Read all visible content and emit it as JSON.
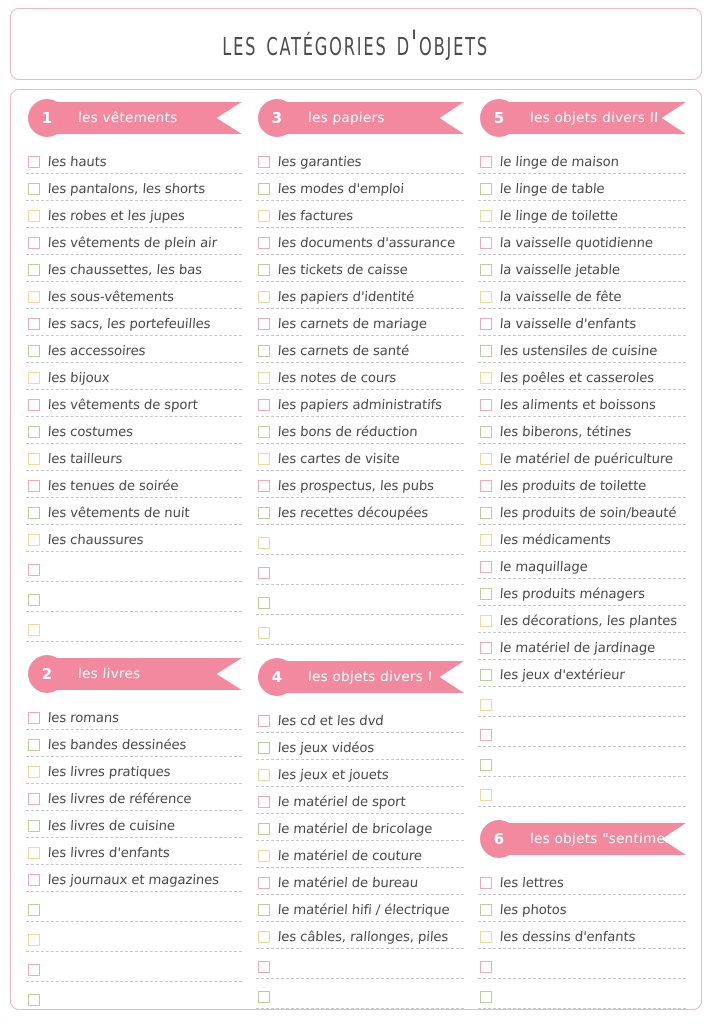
{
  "document": {
    "title": "Les catégories d'objets"
  },
  "colors": {
    "accent_pink": "#F2899F",
    "box_pink": "#F3A8BC",
    "box_green": "#BBCF9E",
    "box_yellow": "#F6D79A",
    "border_pink": "#F2B6C3",
    "blob_yellow": "#F8D48A",
    "blob_green": "#B3CC91",
    "blob_pink": "#EE7E9B",
    "text_dark": "#4A4A4A"
  },
  "header": {
    "blobs_left": [
      "blob_yellow",
      "blob_green",
      "blob_pink"
    ],
    "blobs_right": [
      "blob_pink",
      "blob_green",
      "blob_yellow"
    ]
  },
  "sections": [
    {
      "number": "1",
      "label": "les vêtements",
      "items": [
        "les hauts",
        "les pantalons, les shorts",
        "les robes et les jupes",
        "les vêtements de plein air",
        "les chaussettes, les bas",
        "les sous-vêtements",
        "les sacs, les portefeuilles",
        "les accessoires",
        "les bijoux",
        "les vêtements de sport",
        "les costumes",
        "les tailleurs",
        "les tenues de soirée",
        "les vêtements de nuit",
        "les chaussures"
      ],
      "blank_rows": 3
    },
    {
      "number": "2",
      "label": "les livres",
      "items": [
        "les romans",
        "les bandes dessinées",
        "les livres pratiques",
        "les livres de référence",
        "les livres de cuisine",
        "les livres d'enfants",
        "les journaux et magazines"
      ],
      "blank_rows": 4
    },
    {
      "number": "3",
      "label": "les papiers",
      "items": [
        "les garanties",
        "les modes d'emploi",
        "les factures",
        "les documents d'assurance",
        "les tickets de caisse",
        "les papiers d'identité",
        "les carnets de mariage",
        "les carnets de santé",
        "les notes de cours",
        "les papiers administratifs",
        "les bons de réduction",
        "les cartes de visite",
        "les prospectus, les pubs",
        "les recettes découpées"
      ],
      "blank_rows": 4
    },
    {
      "number": "4",
      "label": "les objets divers I",
      "items": [
        "les cd et les dvd",
        "les jeux vidéos",
        "les jeux et jouets",
        "le matériel de sport",
        "le matériel de bricolage",
        "le matériel de couture",
        "le matériel de bureau",
        "le matériel hifi / électrique",
        "les câbles, rallonges, piles"
      ],
      "blank_rows": 2
    },
    {
      "number": "5",
      "label": "les objets divers II",
      "items": [
        "le linge de maison",
        "le linge de table",
        "le linge de toilette",
        "la vaisselle quotidienne",
        "la vaisselle jetable",
        "la vaisselle de fête",
        "la vaisselle d'enfants",
        "les ustensiles de cuisine",
        "les poêles et casseroles",
        "les aliments et boissons",
        "les biberons, tétines",
        "le matériel de puériculture",
        "les produits de toilette",
        "les produits de soin/beauté",
        "les médicaments",
        "le maquillage",
        "les produits ménagers",
        "les décorations, les plantes",
        "le matériel de jardinage",
        "les jeux d'extérieur"
      ],
      "blank_rows": 4
    },
    {
      "number": "6",
      "label": "les objets \"sentiment\"",
      "items": [
        "les lettres",
        "les photos",
        "les dessins d'enfants"
      ],
      "blank_rows": 2
    }
  ],
  "layout": {
    "columns": [
      [
        0,
        1
      ],
      [
        2,
        3
      ],
      [
        4,
        5
      ]
    ]
  }
}
